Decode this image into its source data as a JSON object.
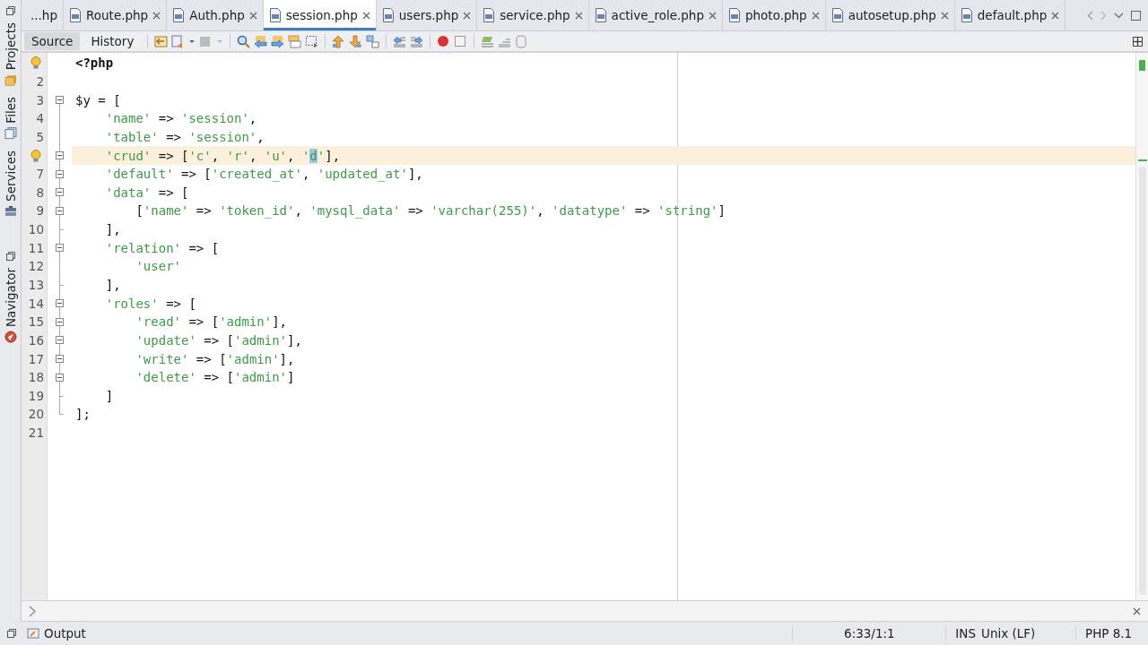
{
  "side_panels": [
    {
      "label": "Projects"
    },
    {
      "label": "Files"
    },
    {
      "label": "Services"
    },
    {
      "label": "Navigator"
    }
  ],
  "tabs": [
    {
      "label": "...hp",
      "kind": "partial",
      "selected": false
    },
    {
      "label": "Route.php",
      "kind": "file",
      "selected": false
    },
    {
      "label": "Auth.php",
      "kind": "file",
      "selected": false
    },
    {
      "label": "session.php",
      "kind": "file",
      "selected": true
    },
    {
      "label": "users.php",
      "kind": "file",
      "selected": false
    },
    {
      "label": "service.php",
      "kind": "file",
      "selected": false
    },
    {
      "label": "active_role.php",
      "kind": "file",
      "selected": false
    },
    {
      "label": "photo.php",
      "kind": "file",
      "selected": false
    },
    {
      "label": "autosetup.php",
      "kind": "file",
      "selected": false
    },
    {
      "label": "default.php",
      "kind": "file",
      "selected": false
    }
  ],
  "toolbar": {
    "views": [
      {
        "label": "Source",
        "selected": true
      },
      {
        "label": "History",
        "selected": false
      }
    ]
  },
  "editor": {
    "lines": [
      {
        "hint": true,
        "tokens": [
          {
            "kind": "keyword",
            "text": "<?php"
          }
        ]
      },
      {
        "number": "2"
      },
      {
        "number": "3",
        "fold": true,
        "tokens": [
          {
            "kind": "plain",
            "text": "$y = ["
          }
        ],
        "children": [
          {
            "number": "4",
            "tokens": [
              {
                "kind": "string",
                "text": "'name'"
              },
              {
                "kind": "plain",
                "text": " => "
              },
              {
                "kind": "string",
                "text": "'session'"
              },
              {
                "kind": "plain",
                "text": ","
              }
            ]
          },
          {
            "number": "5",
            "tokens": [
              {
                "kind": "string",
                "text": "'table'"
              },
              {
                "kind": "plain",
                "text": " => "
              },
              {
                "kind": "string",
                "text": "'session'"
              },
              {
                "kind": "plain",
                "text": ","
              }
            ]
          },
          {
            "hint": true,
            "current": true,
            "fold": true,
            "tokens": [
              {
                "kind": "string",
                "text": "'crud'"
              },
              {
                "kind": "plain",
                "text": " => ["
              },
              {
                "kind": "string",
                "text": "'c'"
              },
              {
                "kind": "plain",
                "text": ", "
              },
              {
                "kind": "string",
                "text": "'r'"
              },
              {
                "kind": "plain",
                "text": ", "
              },
              {
                "kind": "string",
                "text": "'u'"
              },
              {
                "kind": "plain",
                "text": ", "
              },
              {
                "kind": "string",
                "text": "'"
              },
              {
                "kind": "selection",
                "text": "d"
              },
              {
                "kind": "string",
                "text": "'"
              },
              {
                "kind": "plain",
                "text": "],"
              }
            ]
          },
          {
            "number": "7",
            "fold": true,
            "tokens": [
              {
                "kind": "string",
                "text": "'default'"
              },
              {
                "kind": "plain",
                "text": " => ["
              },
              {
                "kind": "string",
                "text": "'created_at'"
              },
              {
                "kind": "plain",
                "text": ", "
              },
              {
                "kind": "string",
                "text": "'updated_at'"
              },
              {
                "kind": "plain",
                "text": "],"
              }
            ]
          },
          {
            "number": "8",
            "fold": true,
            "tokens": [
              {
                "kind": "string",
                "text": "'data'"
              },
              {
                "kind": "plain",
                "text": " => ["
              }
            ],
            "children": [
              {
                "number": "9",
                "fold": true,
                "tokens": [
                  {
                    "kind": "plain",
                    "text": "["
                  },
                  {
                    "kind": "string",
                    "text": "'name'"
                  },
                  {
                    "kind": "plain",
                    "text": " => "
                  },
                  {
                    "kind": "string",
                    "text": "'token_id'"
                  },
                  {
                    "kind": "plain",
                    "text": ", "
                  },
                  {
                    "kind": "string",
                    "text": "'mysql_data'"
                  },
                  {
                    "kind": "plain",
                    "text": " => "
                  },
                  {
                    "kind": "string",
                    "text": "'varchar(255)'"
                  },
                  {
                    "kind": "plain",
                    "text": ", "
                  },
                  {
                    "kind": "string",
                    "text": "'datatype'"
                  },
                  {
                    "kind": "plain",
                    "text": " => "
                  },
                  {
                    "kind": "string",
                    "text": "'string'"
                  },
                  {
                    "kind": "plain",
                    "text": "]"
                  }
                ]
              }
            ]
          },
          {
            "number": "10",
            "tokens": [
              {
                "kind": "plain",
                "text": "],"
              }
            ]
          },
          {
            "number": "11",
            "fold": true,
            "tokens": [
              {
                "kind": "string",
                "text": "'relation'"
              },
              {
                "kind": "plain",
                "text": " => ["
              }
            ],
            "children": [
              {
                "number": "12",
                "tokens": [
                  {
                    "kind": "string",
                    "text": "'user'"
                  }
                ]
              }
            ]
          },
          {
            "number": "13",
            "tokens": [
              {
                "kind": "plain",
                "text": "],"
              }
            ]
          },
          {
            "number": "14",
            "fold": true,
            "tokens": [
              {
                "kind": "string",
                "text": "'roles'"
              },
              {
                "kind": "plain",
                "text": " => ["
              }
            ],
            "children": [
              {
                "number": "15",
                "fold": true,
                "tokens": [
                  {
                    "kind": "string",
                    "text": "'read'"
                  },
                  {
                    "kind": "plain",
                    "text": " => ["
                  },
                  {
                    "kind": "string",
                    "text": "'admin'"
                  },
                  {
                    "kind": "plain",
                    "text": "],"
                  }
                ]
              },
              {
                "number": "16",
                "fold": true,
                "tokens": [
                  {
                    "kind": "string",
                    "text": "'update'"
                  },
                  {
                    "kind": "plain",
                    "text": " => ["
                  },
                  {
                    "kind": "string",
                    "text": "'admin'"
                  },
                  {
                    "kind": "plain",
                    "text": "],"
                  }
                ]
              },
              {
                "number": "17",
                "fold": true,
                "tokens": [
                  {
                    "kind": "string",
                    "text": "'write'"
                  },
                  {
                    "kind": "plain",
                    "text": " => ["
                  },
                  {
                    "kind": "string",
                    "text": "'admin'"
                  },
                  {
                    "kind": "plain",
                    "text": "],"
                  }
                ]
              },
              {
                "number": "18",
                "fold": true,
                "tokens": [
                  {
                    "kind": "string",
                    "text": "'delete'"
                  },
                  {
                    "kind": "plain",
                    "text": " => ["
                  },
                  {
                    "kind": "string",
                    "text": "'admin'"
                  },
                  {
                    "kind": "plain",
                    "text": "]"
                  }
                ]
              }
            ]
          },
          {
            "number": "19",
            "tokens": [
              {
                "kind": "plain",
                "text": "]"
              }
            ]
          }
        ]
      },
      {
        "number": "20",
        "tokens": [
          {
            "kind": "plain",
            "text": "];"
          }
        ]
      },
      {
        "number": "21"
      }
    ]
  },
  "status_bar": {
    "panel": "Output",
    "position": "6:33/1:1",
    "insert_mode": "INS",
    "line_endings": "Unix (LF)",
    "language": "PHP 8.1"
  }
}
